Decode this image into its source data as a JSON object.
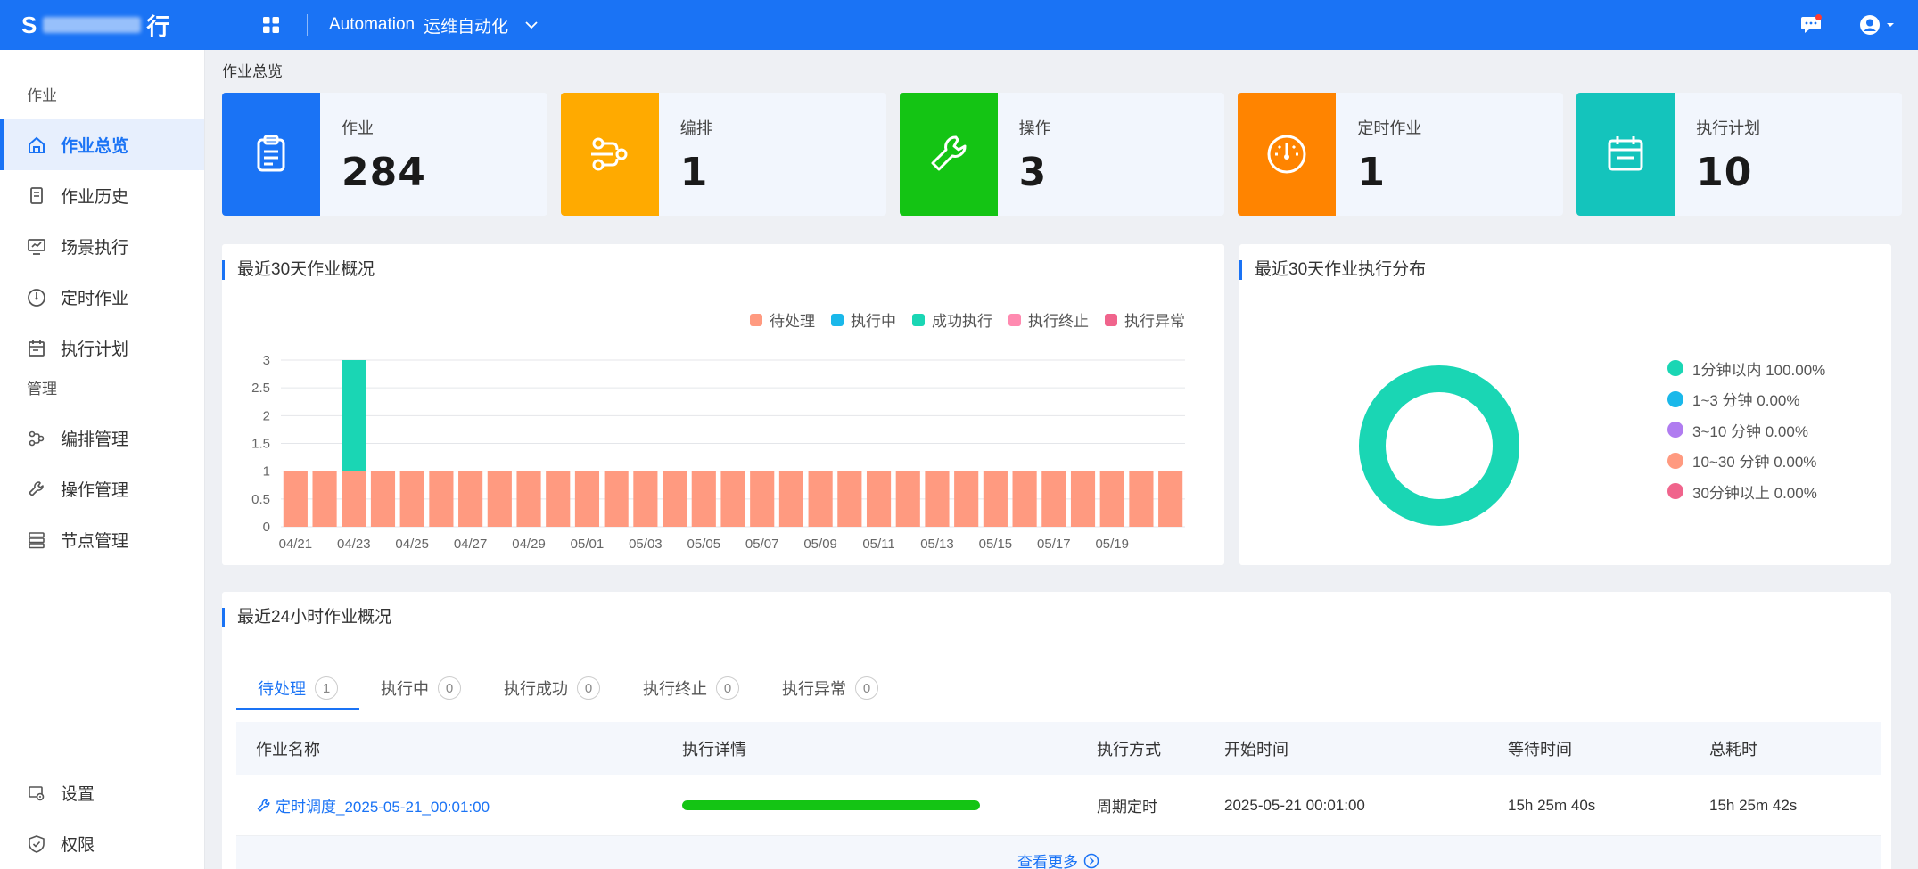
{
  "topbar": {
    "logo_text_start": "S",
    "logo_text_end": "行",
    "module_latin": "Automation",
    "module_cn": "运维自动化"
  },
  "sidebar": {
    "group1": "作业",
    "group2": "管理",
    "items": [
      {
        "label": "作业总览",
        "icon": "home-icon"
      },
      {
        "label": "作业历史",
        "icon": "document-icon"
      },
      {
        "label": "场景执行",
        "icon": "monitor-icon"
      },
      {
        "label": "定时作业",
        "icon": "gauge-icon"
      },
      {
        "label": "执行计划",
        "icon": "calendar-icon"
      },
      {
        "label": "编排管理",
        "icon": "flow-icon"
      },
      {
        "label": "操作管理",
        "icon": "wrench-icon"
      },
      {
        "label": "节点管理",
        "icon": "server-icon"
      }
    ],
    "bottom": [
      {
        "label": "设置",
        "icon": "settings-icon"
      },
      {
        "label": "权限",
        "icon": "shield-icon"
      }
    ]
  },
  "breadcrumb": "作业总览",
  "stats": [
    {
      "label": "作业",
      "value": "284",
      "color": "#1a73f5",
      "icon": "clipboard-icon"
    },
    {
      "label": "编排",
      "value": "1",
      "color": "#ffaa00",
      "icon": "flow-icon"
    },
    {
      "label": "操作",
      "value": "3",
      "color": "#14c414",
      "icon": "wrench-icon"
    },
    {
      "label": "定时作业",
      "value": "1",
      "color": "#ff8400",
      "icon": "gauge-icon"
    },
    {
      "label": "执行计划",
      "value": "10",
      "color": "#14c4bc",
      "icon": "calendar-icon"
    }
  ],
  "bar_panel": {
    "title": "最近30天作业概况",
    "legend": [
      {
        "name": "待处理",
        "color": "#ff9a80"
      },
      {
        "name": "执行中",
        "color": "#1ab8ea"
      },
      {
        "name": "成功执行",
        "color": "#1ad6b4"
      },
      {
        "name": "执行终止",
        "color": "#ff8ab0"
      },
      {
        "name": "执行异常",
        "color": "#f0648c"
      }
    ]
  },
  "donut_panel": {
    "title": "最近30天作业执行分布",
    "legend": [
      {
        "label": "1分钟以内 100.00%",
        "color": "#1ad6b4"
      },
      {
        "label": "1~3 分钟 0.00%",
        "color": "#1ab8ea"
      },
      {
        "label": "3~10 分钟 0.00%",
        "color": "#b07cf0"
      },
      {
        "label": "10~30 分钟 0.00%",
        "color": "#ff9a80"
      },
      {
        "label": "30分钟以上 0.00%",
        "color": "#f0648c"
      }
    ]
  },
  "chart_data": [
    {
      "type": "bar",
      "stacked": true,
      "title": "最近30天作业概况",
      "categories": [
        "04/21",
        "04/22",
        "04/23",
        "04/24",
        "04/25",
        "04/26",
        "04/27",
        "04/28",
        "04/29",
        "04/30",
        "05/01",
        "05/02",
        "05/03",
        "05/04",
        "05/05",
        "05/06",
        "05/07",
        "05/08",
        "05/09",
        "05/10",
        "05/11",
        "05/12",
        "05/13",
        "05/14",
        "05/15",
        "05/16",
        "05/17",
        "05/18",
        "05/19",
        "05/20",
        "05/21"
      ],
      "tick_labels": [
        "04/21",
        "04/23",
        "04/25",
        "04/27",
        "04/29",
        "05/01",
        "05/03",
        "05/05",
        "05/07",
        "05/09",
        "05/11",
        "05/13",
        "05/15",
        "05/17",
        "05/19"
      ],
      "series": [
        {
          "name": "待处理",
          "color": "#ff9a80",
          "values": [
            1,
            1,
            1,
            1,
            1,
            1,
            1,
            1,
            1,
            1,
            1,
            1,
            1,
            1,
            1,
            1,
            1,
            1,
            1,
            1,
            1,
            1,
            1,
            1,
            1,
            1,
            1,
            1,
            1,
            1,
            1
          ]
        },
        {
          "name": "执行中",
          "color": "#1ab8ea",
          "values": [
            0,
            0,
            0,
            0,
            0,
            0,
            0,
            0,
            0,
            0,
            0,
            0,
            0,
            0,
            0,
            0,
            0,
            0,
            0,
            0,
            0,
            0,
            0,
            0,
            0,
            0,
            0,
            0,
            0,
            0,
            0
          ]
        },
        {
          "name": "成功执行",
          "color": "#1ad6b4",
          "values": [
            0,
            0,
            2,
            0,
            0,
            0,
            0,
            0,
            0,
            0,
            0,
            0,
            0,
            0,
            0,
            0,
            0,
            0,
            0,
            0,
            0,
            0,
            0,
            0,
            0,
            0,
            0,
            0,
            0,
            0,
            0
          ]
        },
        {
          "name": "执行终止",
          "color": "#ff8ab0",
          "values": [
            0,
            0,
            0,
            0,
            0,
            0,
            0,
            0,
            0,
            0,
            0,
            0,
            0,
            0,
            0,
            0,
            0,
            0,
            0,
            0,
            0,
            0,
            0,
            0,
            0,
            0,
            0,
            0,
            0,
            0,
            0
          ]
        },
        {
          "name": "执行异常",
          "color": "#f0648c",
          "values": [
            0,
            0,
            0,
            0,
            0,
            0,
            0,
            0,
            0,
            0,
            0,
            0,
            0,
            0,
            0,
            0,
            0,
            0,
            0,
            0,
            0,
            0,
            0,
            0,
            0,
            0,
            0,
            0,
            0,
            0,
            0
          ]
        }
      ],
      "ylim": [
        0,
        3
      ],
      "yticks": [
        "0",
        "0.5",
        "1",
        "1.5",
        "2",
        "2.5",
        "3"
      ],
      "grid": true,
      "legend_position": "top-right"
    },
    {
      "type": "pie",
      "donut": true,
      "title": "最近30天作业执行分布",
      "categories": [
        "1分钟以内",
        "1~3 分钟",
        "3~10 分钟",
        "10~30 分钟",
        "30分钟以上"
      ],
      "values": [
        100,
        0,
        0,
        0,
        0
      ],
      "legend_position": "right"
    }
  ],
  "tasks_panel": {
    "title": "最近24小时作业概况",
    "tabs": [
      {
        "label": "待处理",
        "count": "1"
      },
      {
        "label": "执行中",
        "count": "0"
      },
      {
        "label": "执行成功",
        "count": "0"
      },
      {
        "label": "执行终止",
        "count": "0"
      },
      {
        "label": "执行异常",
        "count": "0"
      }
    ],
    "columns": [
      "作业名称",
      "执行详情",
      "执行方式",
      "开始时间",
      "等待时间",
      "总耗时"
    ],
    "rows": [
      {
        "name": "定时调度_2025-05-21_00:01:00",
        "progress": 1.0,
        "mode": "周期定时",
        "start": "2025-05-21 00:01:00",
        "wait": "15h 25m 40s",
        "total": "15h 25m 42s"
      }
    ],
    "more": "查看更多"
  }
}
